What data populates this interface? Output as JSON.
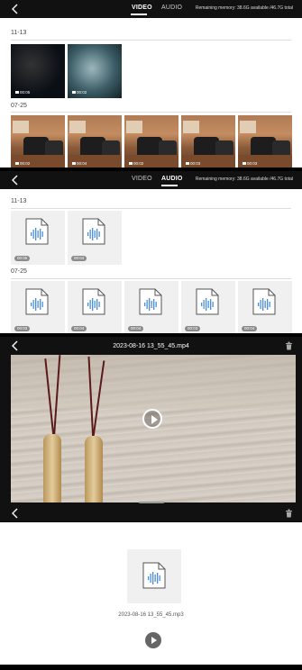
{
  "video_list": {
    "tabs": [
      {
        "label": "VIDEO",
        "active": true
      },
      {
        "label": "AUDIO",
        "active": false
      }
    ],
    "memory": "Remaining memory: 38.6G available /46.7G total",
    "groups": [
      {
        "date": "11-13",
        "items": [
          "00:05",
          "00:02"
        ]
      },
      {
        "date": "07-25",
        "items": [
          "00:02",
          "00:04",
          "00:02",
          "00:03",
          "00:03"
        ]
      }
    ]
  },
  "audio_list": {
    "tabs": [
      {
        "label": "VIDEO",
        "active": false
      },
      {
        "label": "AUDIO",
        "active": true
      }
    ],
    "memory": "Remaining memory: 38.6G available /46.7G total",
    "groups": [
      {
        "date": "11-13",
        "items": [
          "00:05",
          "00:04"
        ]
      },
      {
        "date": "07-25",
        "items": [
          "00:03",
          "00:04",
          "00:04",
          "00:03",
          "00:04"
        ]
      }
    ]
  },
  "video_player": {
    "title": "2023-08-16 13_55_45.mp4"
  },
  "audio_player": {
    "filename": "2023-08-16 13_55_45.mp3"
  },
  "colors": {
    "bar": "#111111",
    "audio_icon": "#4a8fd6",
    "pill": "#8a8a8a"
  }
}
